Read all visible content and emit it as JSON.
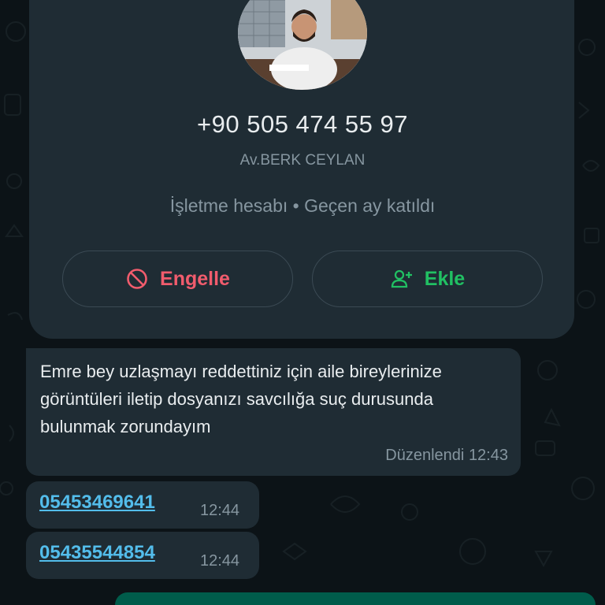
{
  "contact": {
    "phone": "+90 505 474 55 97",
    "name": "Av.BERK CEYLAN",
    "account_info": "İşletme hesabı • Geçen ay katıldı"
  },
  "actions": {
    "block_label": "Engelle",
    "block_icon": "block-icon",
    "add_label": "Ekle",
    "add_icon": "add-contact-icon"
  },
  "messages": [
    {
      "text": "Emre bey uzlaşmayı reddettiniz için aile bireylerinize görüntüleri iletip dosyanızı savcılığa suç durusunda bulunmak zorundayım",
      "status": "Düzenlendi",
      "time": "12:43"
    },
    {
      "link": "05453469641",
      "time": "12:44"
    },
    {
      "link": "05435544854",
      "time": "12:44"
    }
  ],
  "colors": {
    "background": "#0c1317",
    "bubble": "#1f2c34",
    "block": "#f15c6d",
    "add": "#21c063",
    "link": "#53bdeb",
    "outgoing": "#005c4b"
  }
}
